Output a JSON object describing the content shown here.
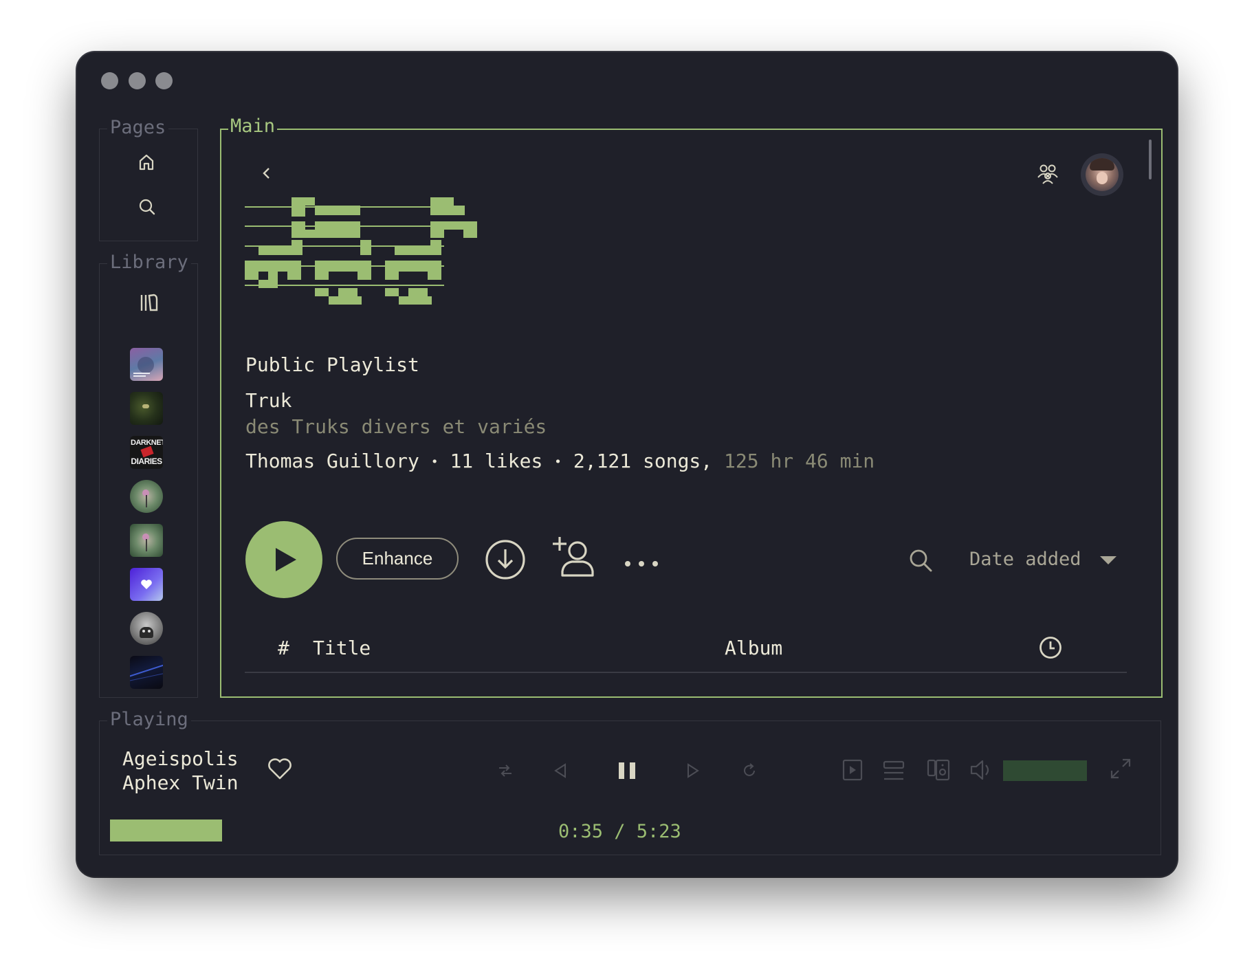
{
  "window": {
    "controls": [
      "close",
      "minimize",
      "zoom"
    ]
  },
  "sidebar": {
    "pages_title": "Pages",
    "pages_items": [
      {
        "icon": "home-icon"
      },
      {
        "icon": "search-icon"
      }
    ],
    "library_title": "Library",
    "library_icon": "library-icon",
    "library_items": [
      {
        "name": "playlist-cover-1"
      },
      {
        "name": "playlist-cover-2"
      },
      {
        "name": "darknet-diaries-cover",
        "text_lines": [
          "DARKNET",
          "DIARIES"
        ]
      },
      {
        "name": "playlist-cover-4"
      },
      {
        "name": "playlist-cover-5"
      },
      {
        "name": "liked-songs-cover"
      },
      {
        "name": "artist-cover-7"
      },
      {
        "name": "playlist-cover-8"
      }
    ]
  },
  "main": {
    "legend": "Main",
    "playlist": {
      "type_label": "Public Playlist",
      "title": "Truk",
      "description": "des Truks divers et variés",
      "owner": "Thomas Guillory",
      "separator": "•",
      "likes": "11 likes",
      "songs": "2,121 songs,",
      "duration": "125 hr 46 min"
    },
    "actions": {
      "enhance_label": "Enhance",
      "sort_label": "Date added"
    },
    "table": {
      "number_header": "#",
      "title_header": "Title",
      "album_header": "Album"
    }
  },
  "player": {
    "legend": "Playing",
    "track_title": "Ageispolis",
    "artist": "Aphex Twin",
    "time": "0:35 / 5:23",
    "progress": 0.108,
    "volume": 1.0
  },
  "colors": {
    "accent": "#9bbd72",
    "background": "#1f2029",
    "text": "#ece9d8",
    "muted": "#8a8a75",
    "border": "#34353e"
  }
}
